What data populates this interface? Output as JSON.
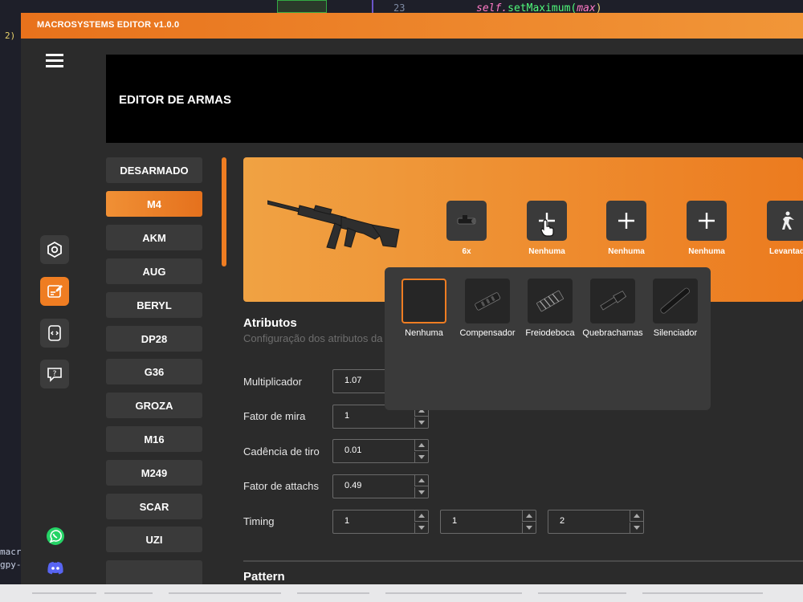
{
  "background": {
    "line_number": "23",
    "code_self": "self.",
    "code_call": "setMaximum(",
    "code_arg": "max",
    "code_end": ")",
    "left_num": "2)",
    "left_lines": [
      "macr",
      "gpy-"
    ]
  },
  "app": {
    "title": "MACROSYSTEMS EDITOR v1.0.0"
  },
  "sidebar": {
    "buttons": [
      "settings-icon",
      "editor-icon",
      "code-icon",
      "help-icon"
    ],
    "active_index": 1,
    "socials": [
      "whatsapp-icon",
      "discord-icon"
    ]
  },
  "header": {
    "title": "EDITOR DE ARMAS"
  },
  "weapons": [
    "DESARMADO",
    "M4",
    "AKM",
    "AUG",
    "BERYL",
    "DP28",
    "G36",
    "GROZA",
    "M16",
    "M249",
    "SCAR",
    "UZI"
  ],
  "active_weapon": "M4",
  "slots": [
    {
      "label": "6x",
      "icon": "scope-icon"
    },
    {
      "label": "Nenhuma",
      "icon": "plus-icon"
    },
    {
      "label": "Nenhuma",
      "icon": "plus-icon"
    },
    {
      "label": "Nenhuma",
      "icon": "plus-icon"
    },
    {
      "label": "Levantad",
      "icon": "stance-icon"
    }
  ],
  "attachments_popup": {
    "options": [
      "Nenhuma",
      "Compensador",
      "Freiodeboca",
      "Quebrachamas",
      "Silenciador"
    ],
    "selected": "Nenhuma"
  },
  "attributes": {
    "title": "Atributos",
    "subtitle": "Configuração dos atributos da",
    "multiplicador": {
      "label": "Multiplicador",
      "value": "1.07"
    },
    "fator_mira": {
      "label": "Fator de mira",
      "value": "1"
    },
    "cadencia": {
      "label": "Cadência de tiro",
      "value": "0.01"
    },
    "fator_attachs": {
      "label": "Fator de attachs",
      "value": "0.49"
    },
    "timing": {
      "label": "Timing",
      "values": [
        "1",
        "1",
        "2"
      ]
    }
  },
  "pattern": {
    "title": "Pattern"
  },
  "colors": {
    "accent": "#ef7d22",
    "panel": "#2b2b2b",
    "button": "#3a3a3a"
  }
}
